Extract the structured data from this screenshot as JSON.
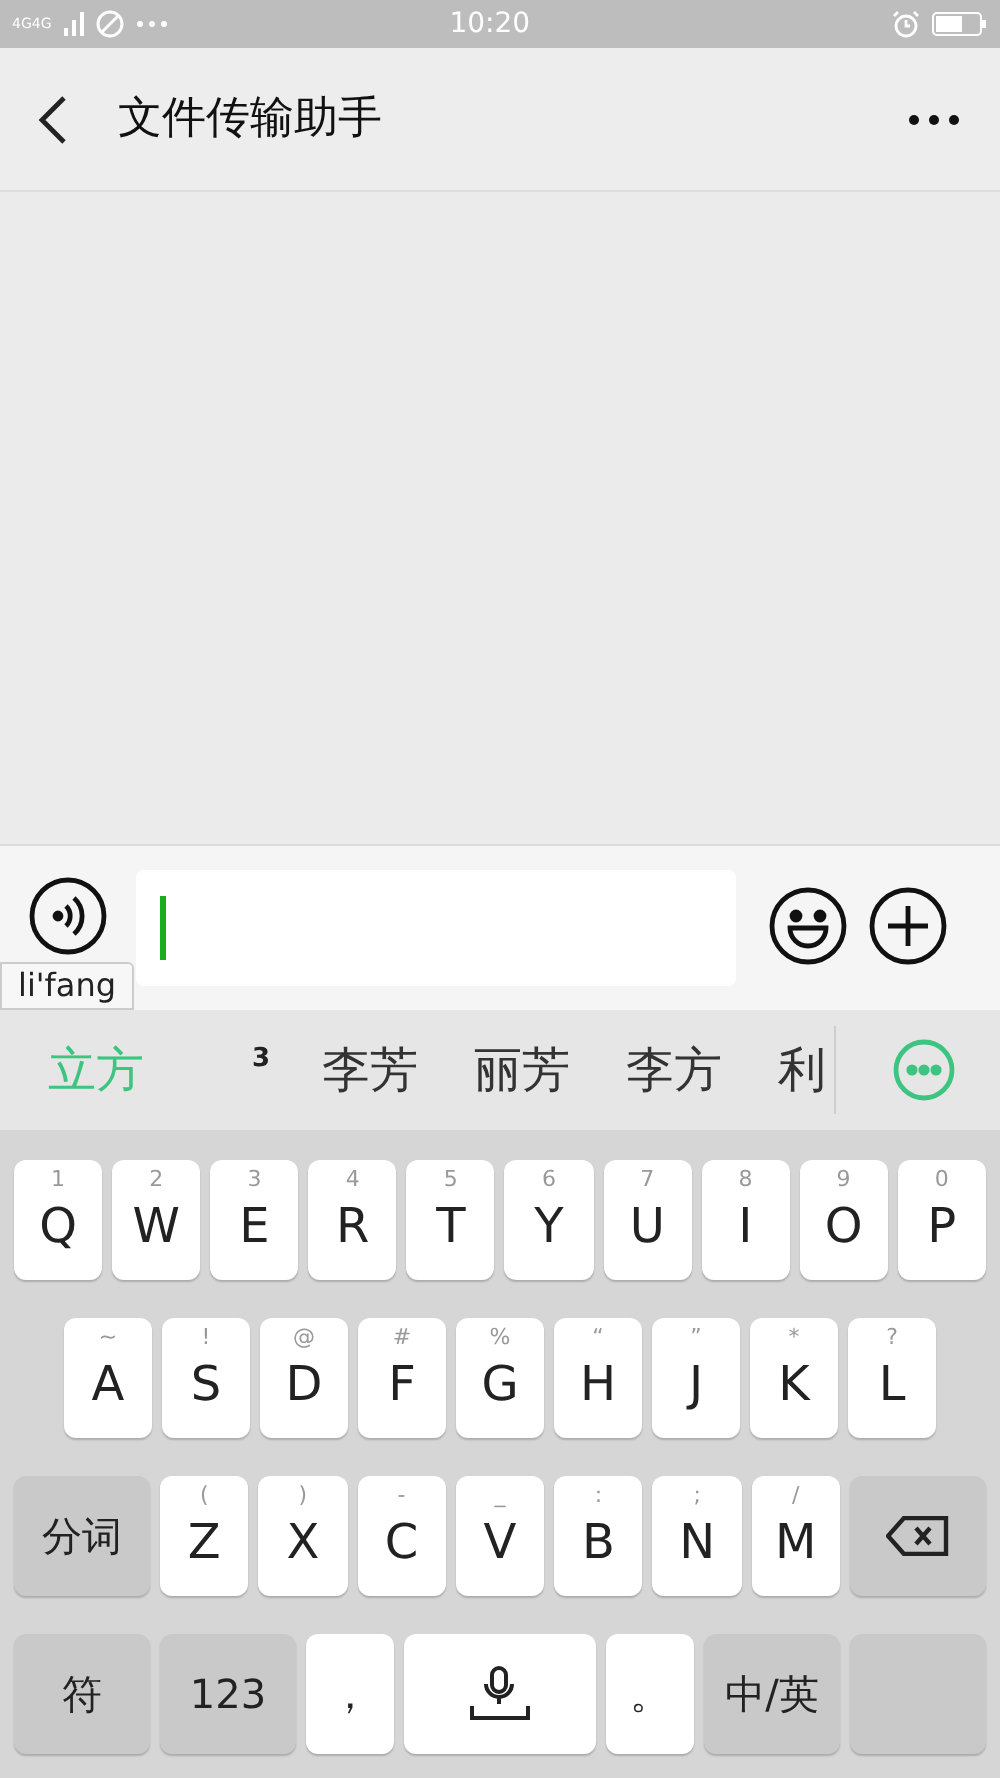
{
  "status_bar": {
    "network": "4G4G",
    "time": "10:20"
  },
  "header": {
    "title": "文件传输助手"
  },
  "input_bar": {
    "composing": "li'fang"
  },
  "candidates": [
    {
      "kind": "word",
      "text": "立方",
      "selected": true
    },
    {
      "kind": "count",
      "text": "3",
      "selected": false
    },
    {
      "kind": "word",
      "text": "李芳",
      "selected": false
    },
    {
      "kind": "word",
      "text": "丽芳",
      "selected": false
    },
    {
      "kind": "word",
      "text": "李方",
      "selected": false
    },
    {
      "kind": "word",
      "text": "利",
      "selected": false
    }
  ],
  "keyboard": {
    "rows": [
      {
        "keys": [
          {
            "kind": "letter",
            "label": "Q",
            "hint": "1"
          },
          {
            "kind": "letter",
            "label": "W",
            "hint": "2"
          },
          {
            "kind": "letter",
            "label": "E",
            "hint": "3"
          },
          {
            "kind": "letter",
            "label": "R",
            "hint": "4"
          },
          {
            "kind": "letter",
            "label": "T",
            "hint": "5"
          },
          {
            "kind": "letter",
            "label": "Y",
            "hint": "6"
          },
          {
            "kind": "letter",
            "label": "U",
            "hint": "7"
          },
          {
            "kind": "letter",
            "label": "I",
            "hint": "8"
          },
          {
            "kind": "letter",
            "label": "O",
            "hint": "9"
          },
          {
            "kind": "letter",
            "label": "P",
            "hint": "0"
          }
        ]
      },
      {
        "keys": [
          {
            "kind": "letter",
            "label": "A",
            "hint": "~"
          },
          {
            "kind": "letter",
            "label": "S",
            "hint": "!"
          },
          {
            "kind": "letter",
            "label": "D",
            "hint": "@"
          },
          {
            "kind": "letter",
            "label": "F",
            "hint": "#"
          },
          {
            "kind": "letter",
            "label": "G",
            "hint": "%"
          },
          {
            "kind": "letter",
            "label": "H",
            "hint": "“"
          },
          {
            "kind": "letter",
            "label": "J",
            "hint": "”"
          },
          {
            "kind": "letter",
            "label": "K",
            "hint": "*"
          },
          {
            "kind": "letter",
            "label": "L",
            "hint": "?"
          }
        ]
      },
      {
        "keys": [
          {
            "kind": "function",
            "label": "分词"
          },
          {
            "kind": "letter",
            "label": "Z",
            "hint": "("
          },
          {
            "kind": "letter",
            "label": "X",
            "hint": ")"
          },
          {
            "kind": "letter",
            "label": "C",
            "hint": "-"
          },
          {
            "kind": "letter",
            "label": "V",
            "hint": "_"
          },
          {
            "kind": "letter",
            "label": "B",
            "hint": ":"
          },
          {
            "kind": "letter",
            "label": "N",
            "hint": ";"
          },
          {
            "kind": "letter",
            "label": "M",
            "hint": "/"
          },
          {
            "kind": "backspace"
          }
        ]
      },
      {
        "keys": [
          {
            "kind": "function",
            "label": "符"
          },
          {
            "kind": "function",
            "label": "123"
          },
          {
            "kind": "punct",
            "label": "，"
          },
          {
            "kind": "space"
          },
          {
            "kind": "punct",
            "label": "。"
          },
          {
            "kind": "function",
            "label": "中/英"
          },
          {
            "kind": "enter"
          }
        ]
      }
    ]
  }
}
